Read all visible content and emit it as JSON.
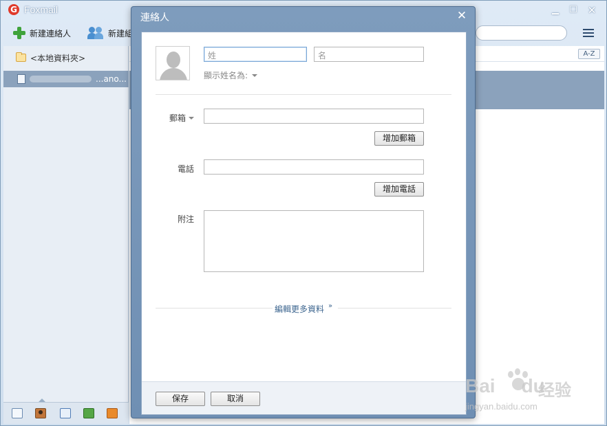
{
  "app": {
    "title": "Foxmail",
    "logo_letter": "G",
    "window_controls": {
      "minimize": "▁",
      "maximize": "☐",
      "close": "✕"
    }
  },
  "toolbar": {
    "new_contact_label": "新建連絡人",
    "new_group_label": "新建組",
    "search_placeholder": ""
  },
  "sidebar": {
    "folder_label": "<本地資料夾>",
    "account_label": "...ano...",
    "bottom_tabs": [
      "mail-icon",
      "contacts-icon",
      "calendar-icon",
      "notes-icon",
      "rss-icon"
    ],
    "active_tab": "contacts-icon"
  },
  "contacts_pane": {
    "sort_button": "A-Z"
  },
  "dialog": {
    "title": "連絡人",
    "close_glyph": "✕",
    "lastname_placeholder": "姓",
    "firstname_placeholder": "名",
    "display_as_label": "顯示姓名為:",
    "email_label": "郵箱",
    "email_value": "",
    "add_email_button": "增加郵箱",
    "phone_label": "電話",
    "phone_value": "",
    "add_phone_button": "增加電話",
    "note_label": "附注",
    "note_value": "",
    "more_info_link": "編輯更多資料",
    "more_info_arrow": "»",
    "save_button": "保存",
    "cancel_button": "取消"
  },
  "watermark": {
    "logo_text": "Bai",
    "logo_text_2": "du",
    "cn_text": "经验",
    "url": "jingyan.baidu.com"
  },
  "colors": {
    "accent": "#7e9cbd",
    "selection": "#8ba2bc",
    "link": "#3f6790",
    "add_green": "#3fa33b"
  }
}
